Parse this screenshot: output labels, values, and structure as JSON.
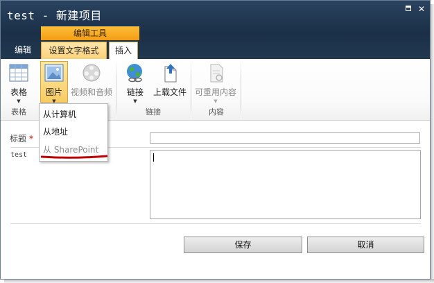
{
  "window": {
    "title": "test - 新建项目"
  },
  "ribbon": {
    "context_group": "编辑工具",
    "tabs": {
      "edit": "编辑",
      "format": "设置文字格式",
      "insert": "插入"
    },
    "buttons": {
      "table": "表格",
      "picture": "图片",
      "video_audio": "视频和音频",
      "link": "链接",
      "upload": "上载文件",
      "reusable": "可重用内容"
    },
    "groups": {
      "table": "表格",
      "link": "链接",
      "content": "内容"
    }
  },
  "picture_menu": {
    "items": [
      "从计算机",
      "从地址",
      "从 SharePoint"
    ]
  },
  "form": {
    "title_label": "标题",
    "required_mark": "*",
    "body_label": "test"
  },
  "actions": {
    "save": "保存",
    "cancel": "取消"
  },
  "colors": {
    "title_bar": "#1b3048",
    "context_tab": "#f59c12",
    "annotation_line": "#c00000"
  }
}
